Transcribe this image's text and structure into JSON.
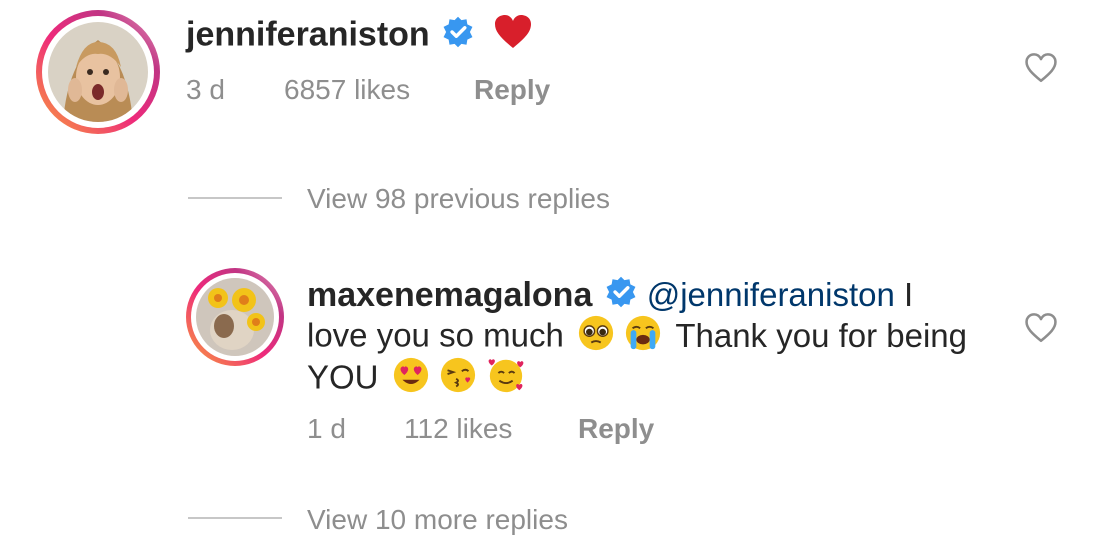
{
  "comment1": {
    "username": "jenniferaniston",
    "time": "3 d",
    "likes": "6857 likes",
    "reply": "Reply",
    "emoji": "heart-emoji"
  },
  "view_previous": "View 98 previous replies",
  "comment2": {
    "username": "maxenemagalona",
    "mention": "@jenniferaniston",
    "line1_tail": "I",
    "line2_a": "love you so much",
    "line2_b": "Thank you for being",
    "line3": "YOU",
    "time": "1 d",
    "likes": "112 likes",
    "reply": "Reply"
  },
  "view_more": "View 10 more replies",
  "colors": {
    "text": "#262626",
    "meta": "#8e8e8e",
    "mention": "#00376b",
    "verified": "#3897f0",
    "heart": "#ed4956"
  }
}
